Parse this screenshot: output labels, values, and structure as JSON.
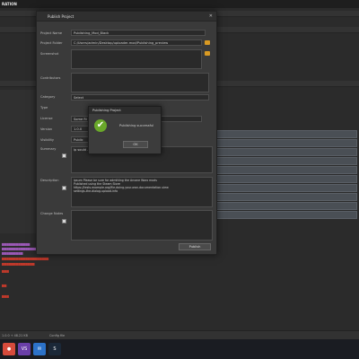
{
  "app": {
    "title": "RATION"
  },
  "dialog": {
    "title": "Publish Project",
    "fields": {
      "project_name_label": "Project Name",
      "project_name_value": "Publishing_Mod_Black",
      "project_folder_label": "Project Folder",
      "project_folder_value": "C:/Users/admin/Desktop/uploader-mod/Publishing_preview",
      "screenshot_label": "Screenshot",
      "contributors_label": "Contributors",
      "category_label": "Category",
      "category_value": "Select",
      "type_label": "Type",
      "license_label": "License",
      "license_value": "Some Ri",
      "version_label": "Version",
      "version_value": "1.0.0",
      "visibility_label": "Visibility",
      "visibility_value": "Public",
      "summary_label": "Summary",
      "summary_text": "ip sould ... make it ... ready, this is just a config",
      "description_label": "Description",
      "description_text": "ipsum Please be sure for admitting the Arcane Worx mods\nPublished using the Steam Store\nhttps://tests.example.org/file-doing-your-own-documentation-view\nsettings-the-dialog-upload-info",
      "change_notes_label": "Change Notes"
    },
    "publish_button": "Publish",
    "close_glyph": "✕"
  },
  "modal": {
    "title": "Publishing Project",
    "message": "Publishing successful",
    "ok_button": "OK",
    "check_glyph": "✔"
  },
  "status_bar": {
    "left": "1.0.0 + 48.21 KB",
    "right": "Config file"
  },
  "taskbar": {
    "icons": [
      {
        "name": "chrome-icon",
        "glyph": "●",
        "color": "#d64b3c"
      },
      {
        "name": "visual-studio-icon",
        "glyph": "VS",
        "color": "#6a3fa8"
      },
      {
        "name": "mail-icon",
        "glyph": "✉",
        "color": "#2c72c9"
      },
      {
        "name": "steam-icon",
        "glyph": "S",
        "color": "#1b2838"
      }
    ]
  },
  "colors": {
    "accent_folder": "#d99a23",
    "success": "#6aa82a",
    "log_red": "#c0392b",
    "log_purple": "#9b59b6"
  }
}
